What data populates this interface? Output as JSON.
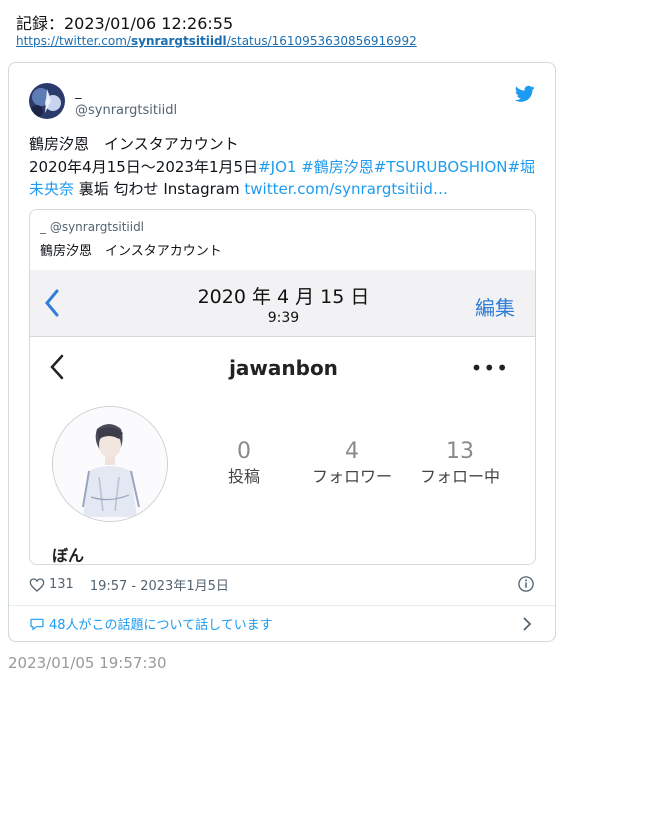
{
  "record": {
    "text": "記録：2023/01/06 12:26:55"
  },
  "source": {
    "prefix": "https://twitter.com/",
    "user": "synrargtsitiidl",
    "suffix": "/status/1610953630856916992"
  },
  "tweet": {
    "display_name": "_",
    "handle": "@synrargtsitiidl",
    "text_line1": "鶴房汐恩　インスタアカウント",
    "text_line2_plain": "2020年4月15日〜2023年1月5日",
    "hashtags": "#JO1 #鶴房汐恩#TSURUBOSHION#堀未央奈",
    "text_tail": " 裏垢 匂わせ Instagram ",
    "link": "twitter.com/synrargtsitiid…",
    "likes": "131",
    "timestamp": "19:57 - 2023年1月5日",
    "discussion": "48人がこの話題について話しています"
  },
  "quote": {
    "author": "_ @synrargtsitiidl",
    "text": "鶴房汐恩　インスタアカウント",
    "screenshot": {
      "date": "2020 年 4 月 15 日",
      "time": "9:39",
      "edit": "編集",
      "username": "jawanbon",
      "more": "•••",
      "stats": [
        {
          "num": "0",
          "label": "投稿"
        },
        {
          "num": "4",
          "label": "フォロワー"
        },
        {
          "num": "13",
          "label": "フォロー中"
        }
      ],
      "name": "ぼん"
    }
  },
  "footer": {
    "timestamp": "2023/01/05 19:57:30"
  },
  "colors": {
    "link": "#1d9bf0",
    "record_link": "#1b6fb0",
    "ios_blue": "#2f7ed8"
  }
}
